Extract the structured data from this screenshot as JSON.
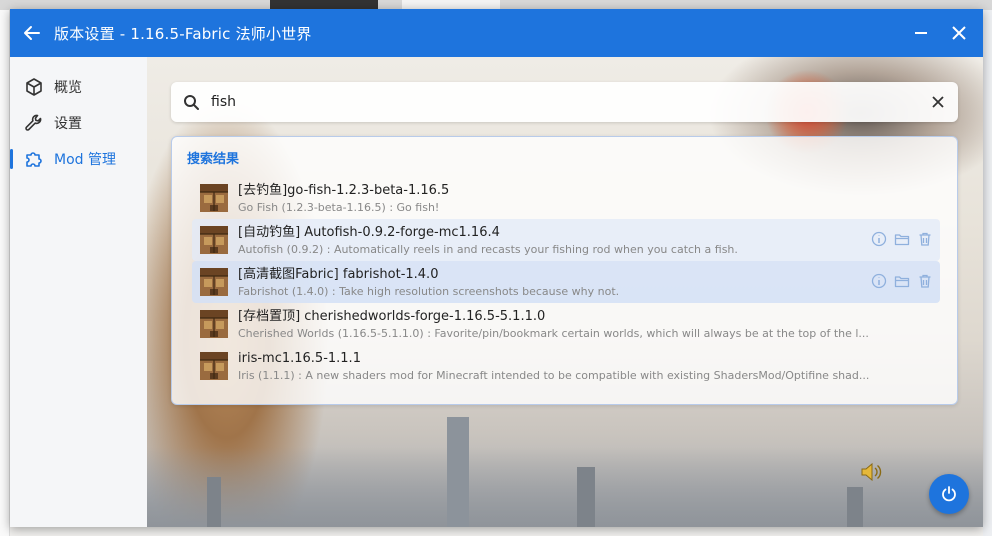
{
  "window": {
    "title": "版本设置 - 1.16.5-Fabric 法师小世界"
  },
  "sidebar": {
    "items": [
      {
        "label": "概览",
        "icon": "cube-icon",
        "active": false
      },
      {
        "label": "设置",
        "icon": "wrench-icon",
        "active": false
      },
      {
        "label": "Mod 管理",
        "icon": "puzzle-icon",
        "active": true
      }
    ]
  },
  "search": {
    "value": "fish",
    "placeholder": ""
  },
  "results": {
    "title": "搜索结果",
    "items": [
      {
        "name": "[去钓鱼]go-fish-1.2.3-beta-1.16.5",
        "desc": "Go Fish (1.2.3-beta-1.16.5) : Go fish!"
      },
      {
        "name": "[自动钓鱼] Autofish-0.9.2-forge-mc1.16.4",
        "desc": "Autofish (0.9.2) : Automatically reels in and recasts your fishing rod when you catch a fish."
      },
      {
        "name": "[高清截图Fabric] fabrishot-1.4.0",
        "desc": "Fabrishot (1.4.0) : Take high resolution screenshots because why not."
      },
      {
        "name": "[存档置顶] cherishedworlds-forge-1.16.5-5.1.1.0",
        "desc": "Cherished Worlds (1.16.5-5.1.1.0) : Favorite/pin/bookmark certain worlds, which will always be at the top of the l..."
      },
      {
        "name": "iris-mc1.16.5-1.1.1",
        "desc": "Iris (1.1.1) : A new shaders mod for Minecraft intended to be compatible with existing ShadersMod/Optifine shad..."
      }
    ]
  },
  "colors": {
    "accent": "#1e74dd",
    "title_text": "#ffffff"
  }
}
